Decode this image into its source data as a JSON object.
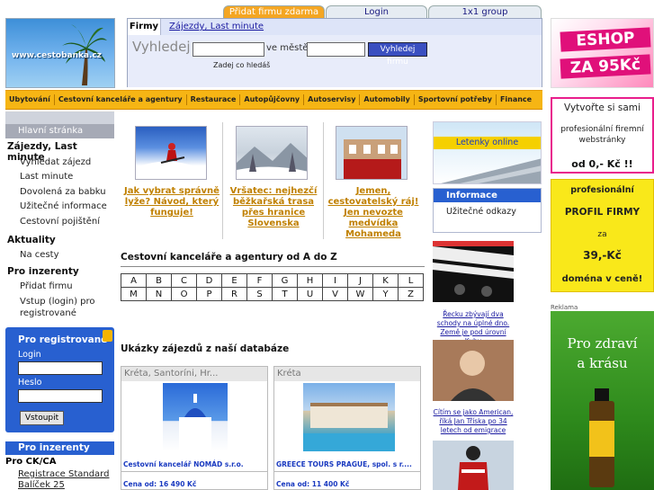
{
  "logo": {
    "text": "www.cestobanka.cz"
  },
  "top_tabs": {
    "pridat": "Přidat firmu zdarma",
    "login": "Login",
    "one_by_one": "1x1 group"
  },
  "search": {
    "tab_firmy": "Firmy",
    "tab_zajezdy": "Zájezdy, Last minute",
    "label": "Vyhledej",
    "ve_meste": "ve městě",
    "button": "Vyhledej firmu",
    "hint": "Zadej co hledáš",
    "query_value": "",
    "city_value": ""
  },
  "categories": [
    "Ubytování",
    "Cestovní kanceláře a agentury",
    "Restaurace",
    "Autopůjčovny",
    "Autoservisy",
    "Automobily",
    "Sportovní potřeby",
    "Finance"
  ],
  "sidebar": {
    "main": "Hlavní stránka",
    "sections": [
      {
        "head": "Zájezdy, Last minute",
        "items": [
          "Vyhledat zájezd",
          "Last minute",
          "Dovolená za babku",
          "Užitečné informace",
          "Cestovní pojištění"
        ]
      },
      {
        "head": "Aktuality",
        "items": [
          "Na cesty"
        ]
      },
      {
        "head": "Pro inzerenty",
        "items": [
          "Přidat firmu",
          "Vstup (login) pro registrované"
        ]
      }
    ],
    "registration": {
      "title": "Pro registrované",
      "login_label": "Login",
      "password_label": "Heslo",
      "button": "Vstoupit"
    },
    "pro_inzerenty": "Pro inzerenty",
    "pro_ckca": "Pro CK/CA",
    "registrace": "Registrace Standard Balíček 25"
  },
  "promos": [
    {
      "title": "Jak vybrat správně lyže? Návod, který funguje!"
    },
    {
      "title": "Vršatec: nejhezčí běžkařská trasa přes hranice Slovenska"
    },
    {
      "title": "Jemen, cestovatelský ráj! Jen nevozte medvídka Mohameda"
    }
  ],
  "az": {
    "title": "Cestovní kanceláře a agentury od A do Z",
    "rows": [
      [
        "A",
        "B",
        "C",
        "D",
        "E",
        "F",
        "G",
        "H",
        "I",
        "J",
        "K",
        "L"
      ],
      [
        "M",
        "N",
        "O",
        "P",
        "R",
        "S",
        "T",
        "U",
        "V",
        "W",
        "Y",
        "Z"
      ]
    ]
  },
  "ukazky": {
    "title": "Ukázky zájezdů z naší databáze",
    "cards": [
      {
        "header": "Kréta, Santoríni, Hr...",
        "agency": "Cestovní kancelář NOMÁD s.r.o.",
        "price": "Cena od: 16 490 Kč"
      },
      {
        "header": "Kréta",
        "agency": "GREECE TOURS PRAGUE, spol. s r....",
        "price": "Cena od: 11 400 Kč"
      }
    ]
  },
  "right": {
    "letenky": "Letenky online",
    "info_title": "Informace",
    "info_item": "Užitečné odkazy",
    "news": [
      "Řecku zbývají dva schody na úplné dno. Země je pod úrovní Kuby",
      "Cítím se jako American, říká Jan Tříska po 34 letech od emigrace"
    ]
  },
  "ads": {
    "eshop_line1": "ESHOP",
    "eshop_line2": "ZA 95Kč",
    "web_line1": "Vytvořte si sami",
    "web_line2": "profesionální firemní webstránky",
    "web_line3": "od 0,- Kč !!",
    "profil_line1": "profesionální",
    "profil_line2": "PROFIL FIRMY",
    "profil_line3": "za",
    "profil_line4": "39,-Kč",
    "profil_line5": "doména v ceně!",
    "reklama": "Reklama",
    "zdravi_line1": "Pro zdraví",
    "zdravi_line2": "a krásu"
  },
  "colors": {
    "accent_orange": "#f6b514",
    "blue": "#2860d0",
    "magenta": "#e91e8c",
    "yellow": "#f9e81a",
    "green": "#2e8a1c"
  }
}
